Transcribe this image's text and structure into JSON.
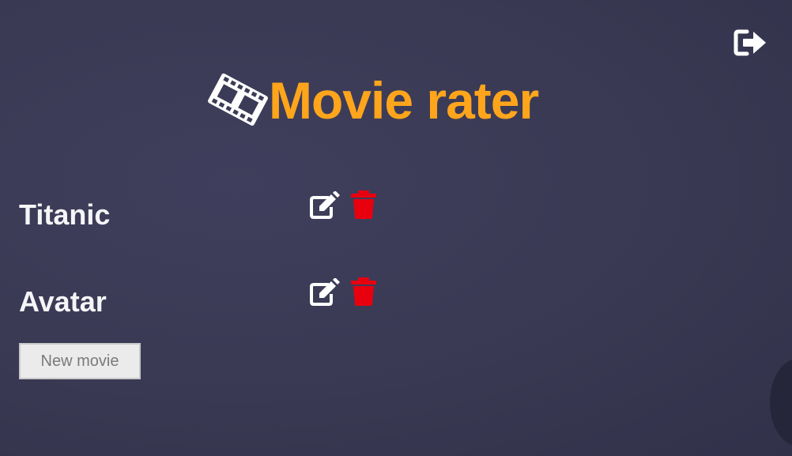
{
  "app": {
    "title": "Movie rater"
  },
  "header": {
    "logo_icon": "film-icon",
    "logout_icon": "sign-out-icon"
  },
  "movies": [
    {
      "title": "Titanic",
      "edit_icon": "edit-icon",
      "delete_icon": "trash-icon"
    },
    {
      "title": "Avatar",
      "edit_icon": "edit-icon",
      "delete_icon": "trash-icon"
    }
  ],
  "actions": {
    "new_movie_label": "New movie"
  },
  "colors": {
    "background": "#3b3b57",
    "title": "#ffa51c",
    "text": "#f5f5f8",
    "delete": "#e8000f",
    "button_bg": "#ebebeb",
    "button_text": "#7a7a7a"
  }
}
